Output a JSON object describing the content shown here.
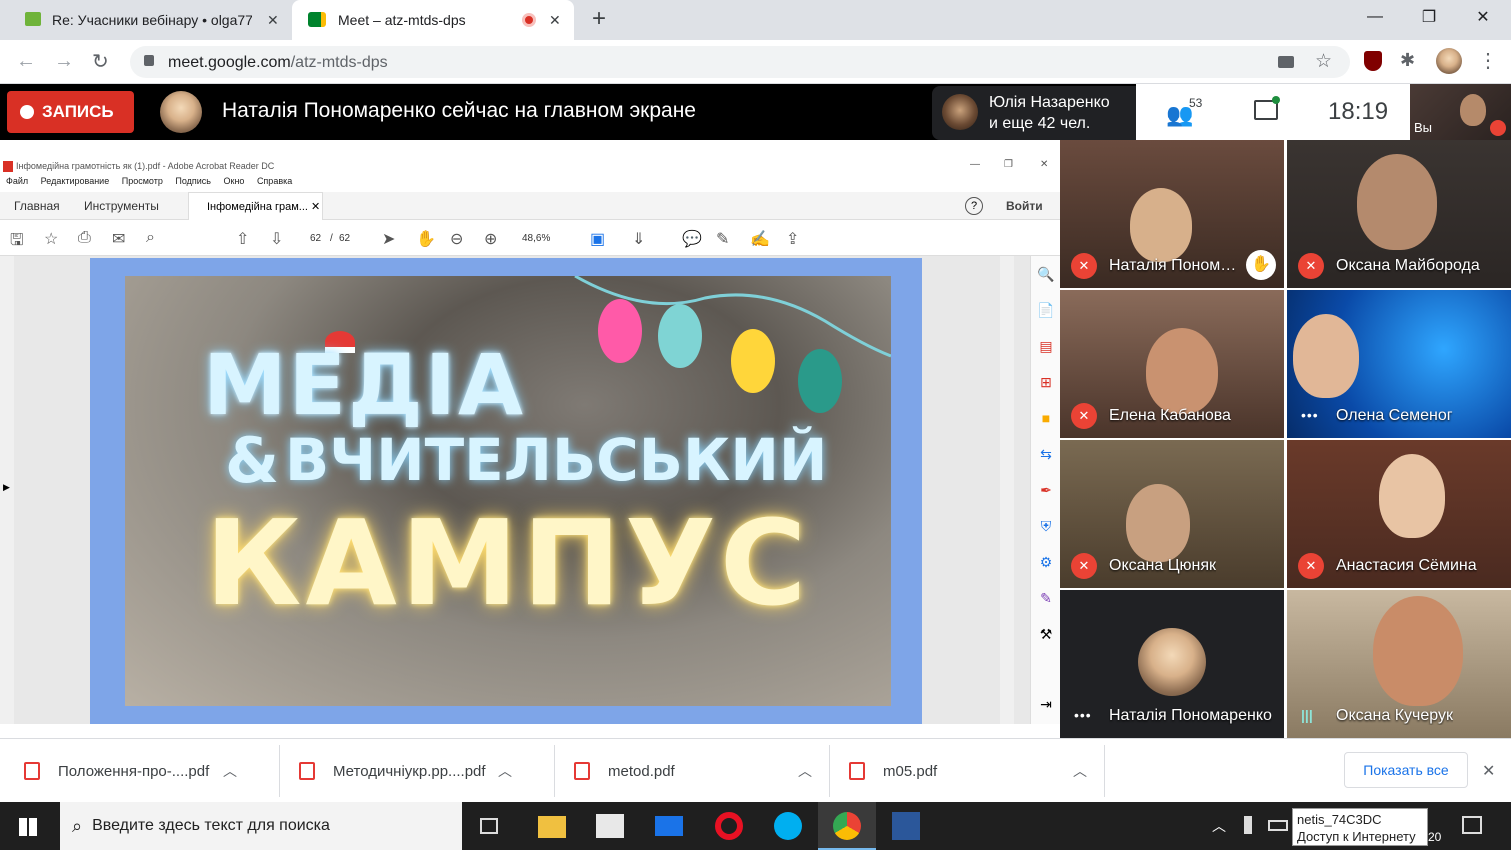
{
  "browser": {
    "tabs": [
      {
        "title": "Re: Учасники вебінару • olga77",
        "close": "✕"
      },
      {
        "title": "Meet – atz-mtds-dps",
        "close": "✕"
      }
    ],
    "new_tab": "+",
    "url_host": "meet.google.com",
    "url_path": "/atz-mtds-dps"
  },
  "meet": {
    "record_label": "ЗАПИСЬ",
    "spotlight_text": "Наталія Пономаренко сейчас на главном экране",
    "presenter_line1": "Юлія Назаренко",
    "presenter_line2": "и еще 42 чел.",
    "participants_count": "53",
    "time": "18:19",
    "self_label": "Вы"
  },
  "acrobat": {
    "window_title": "Інфомедійна грамотність як (1).pdf - Adobe Acrobat Reader DC",
    "menu": [
      "Файл",
      "Редактирование",
      "Просмотр",
      "Подпись",
      "Окно",
      "Справка"
    ],
    "tab_home": "Главная",
    "tab_tools": "Инструменты",
    "tab_doc": "Інфомедійна грам...",
    "signin": "Войти",
    "page_current": "62",
    "page_sep": "/",
    "page_total": "62",
    "zoom": "48,6%",
    "slide_line1": "МЕДІА",
    "slide_amp": "&",
    "slide_line2": "ВЧИТЕЛЬСЬКИЙ",
    "slide_line3": "КАМПУС"
  },
  "participants": [
    {
      "name": "Наталія Пономаренко",
      "status": "muted"
    },
    {
      "name": "Оксана Майборода",
      "status": "muted"
    },
    {
      "name": "Елена Кабанова",
      "status": "muted"
    },
    {
      "name": "Олена Семеног",
      "status": "idle"
    },
    {
      "name": "Оксана Цюняк",
      "status": "muted"
    },
    {
      "name": "Анастасия Сёмина",
      "status": "muted"
    },
    {
      "name": "Наталія Пономаренко",
      "status": "idle"
    },
    {
      "name": "Оксана Кучерук",
      "status": "speaking"
    }
  ],
  "downloads": [
    {
      "name": "Положення-про-....pdf"
    },
    {
      "name": "Методичніукр.рр....pdf"
    },
    {
      "name": "metod.pdf"
    },
    {
      "name": "m05.pdf"
    }
  ],
  "downloads_show_all": "Показать все",
  "taskbar": {
    "search_placeholder": "Введите здесь текст для поиска",
    "tooltip_line1": "netis_74C3DC",
    "tooltip_line2": "Доступ к Интернету",
    "tooltip_tail": "20"
  },
  "colors": {
    "record_red": "#d93025",
    "mic_red": "#ea4335",
    "link_blue": "#1a73e8"
  }
}
